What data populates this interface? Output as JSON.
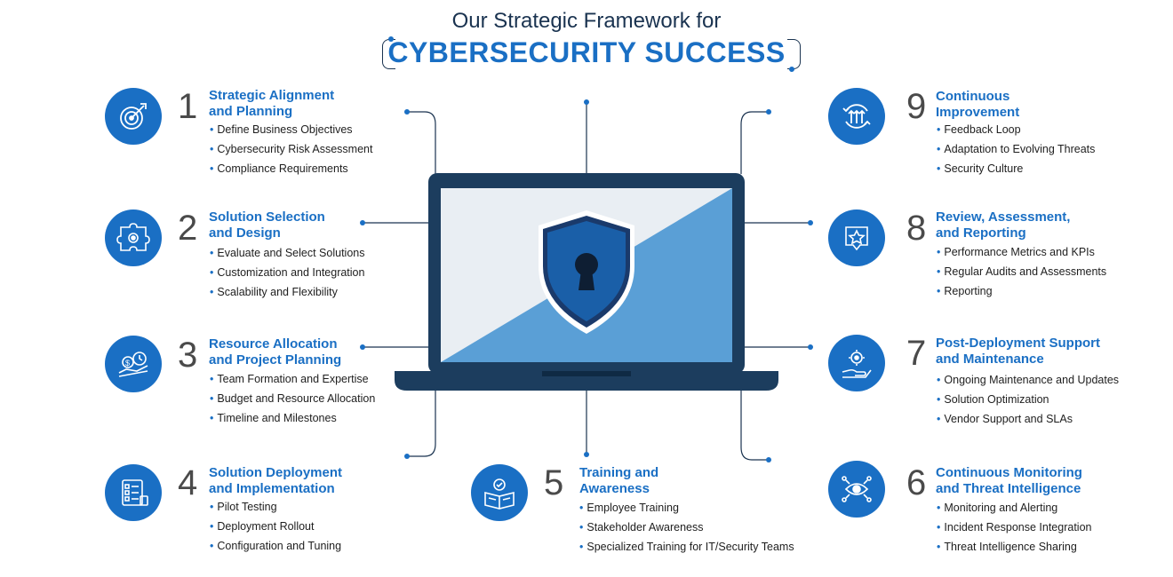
{
  "header": {
    "title_top": "Our Strategic Framework for",
    "title_main": "CYBERSECURITY SUCCESS"
  },
  "steps": [
    {
      "number": "1",
      "title_line1": "Strategic Alignment",
      "title_line2": "and Planning",
      "icon": "target-icon",
      "items": [
        "Define Business Objectives",
        "Cybersecurity Risk Assessment",
        "Compliance Requirements"
      ]
    },
    {
      "number": "2",
      "title_line1": "Solution Selection",
      "title_line2": "and Design",
      "icon": "puzzle-gear-icon",
      "items": [
        "Evaluate and Select Solutions",
        "Customization and Integration",
        "Scalability and Flexibility"
      ]
    },
    {
      "number": "3",
      "title_line1": "Resource Allocation",
      "title_line2": "and Project Planning",
      "icon": "money-clock-icon",
      "items": [
        "Team Formation and Expertise",
        "Budget and Resource Allocation",
        "Timeline and Milestones"
      ]
    },
    {
      "number": "4",
      "title_line1": "Solution Deployment",
      "title_line2": "and Implementation",
      "icon": "checklist-icon",
      "items": [
        "Pilot Testing",
        "Deployment Rollout",
        "Configuration and Tuning"
      ]
    },
    {
      "number": "5",
      "title_line1": "Training and",
      "title_line2": "Awareness",
      "icon": "book-reader-icon",
      "items": [
        "Employee Training",
        "Stakeholder Awareness",
        "Specialized Training for IT/Security Teams"
      ]
    },
    {
      "number": "6",
      "title_line1": "Continuous Monitoring",
      "title_line2": "and Threat Intelligence",
      "icon": "eye-network-icon",
      "items": [
        "Monitoring and Alerting",
        "Incident Response Integration",
        "Threat Intelligence Sharing"
      ]
    },
    {
      "number": "7",
      "title_line1": "Post-Deployment Support",
      "title_line2": "and Maintenance",
      "icon": "hand-gear-icon",
      "items": [
        "Ongoing Maintenance and Updates",
        "Solution Optimization",
        "Vendor Support and SLAs"
      ]
    },
    {
      "number": "8",
      "title_line1": "Review, Assessment,",
      "title_line2": "and Reporting",
      "icon": "star-badge-icon",
      "items": [
        "Performance Metrics and KPIs",
        "Regular Audits and Assessments",
        "Reporting"
      ]
    },
    {
      "number": "9",
      "title_line1": "Continuous",
      "title_line2": "Improvement",
      "icon": "cycle-arrows-icon",
      "items": [
        "Feedback Loop",
        "Adaptation to Evolving Threats",
        "Security Culture"
      ]
    }
  ],
  "colors": {
    "accent": "#1a6fc4",
    "dark": "#1a3350",
    "laptop_frame": "#1c3d5e",
    "screen_light": "#e9eef3",
    "screen_blue": "#5a9fd6",
    "shield": "#1a5fa8"
  }
}
